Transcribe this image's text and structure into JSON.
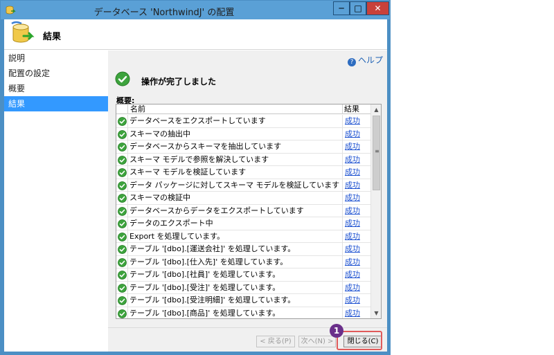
{
  "window": {
    "title": "データベース 'NorthwindJ' の配置",
    "min_glyph": "─",
    "max_glyph": "□",
    "close_glyph": "✕"
  },
  "header": {
    "title": "結果"
  },
  "sidebar": {
    "items": [
      {
        "label": "説明",
        "active": false
      },
      {
        "label": "配置の設定",
        "active": false
      },
      {
        "label": "概要",
        "active": false
      },
      {
        "label": "結果",
        "active": true
      }
    ]
  },
  "content": {
    "help_label": "ヘルプ",
    "status_text": "操作が完了しました",
    "summary_label": "概要:",
    "columns": {
      "name": "名前",
      "result": "結果"
    },
    "rows": [
      {
        "name": "データベースをエクスポートしています",
        "result": "成功"
      },
      {
        "name": "スキーマの抽出中",
        "result": "成功"
      },
      {
        "name": "データベースからスキーマを抽出しています",
        "result": "成功"
      },
      {
        "name": "スキーマ モデルで参照を解決しています",
        "result": "成功"
      },
      {
        "name": "スキーマ モデルを検証しています",
        "result": "成功"
      },
      {
        "name": "データ パッケージに対してスキーマ モデルを検証しています",
        "result": "成功"
      },
      {
        "name": "スキーマの検証中",
        "result": "成功"
      },
      {
        "name": "データベースからデータをエクスポートしています",
        "result": "成功"
      },
      {
        "name": "データのエクスポート中",
        "result": "成功"
      },
      {
        "name": "Export を処理しています。",
        "result": "成功"
      },
      {
        "name": "テーブル '[dbo].[運送会社]' を処理しています。",
        "result": "成功"
      },
      {
        "name": "テーブル '[dbo].[仕入先]' を処理しています。",
        "result": "成功"
      },
      {
        "name": "テーブル '[dbo].[社員]' を処理しています。",
        "result": "成功"
      },
      {
        "name": "テーブル '[dbo].[受注]' を処理しています。",
        "result": "成功"
      },
      {
        "name": "テーブル '[dbo].[受注明細]' を処理しています。",
        "result": "成功"
      },
      {
        "name": "テーブル '[dbo].[商品]' を処理しています。",
        "result": "成功"
      }
    ]
  },
  "footer": {
    "back_label": "< 戻る(P)",
    "next_label": "次へ(N) >",
    "close_label": "閉じる(C)"
  },
  "callout": {
    "number": "1"
  },
  "colors": {
    "titlebar": "#5aa0d6",
    "selection": "#3399ff",
    "success_icon": "#3da33d",
    "link": "#1a4fd0",
    "callout": "#6a2f8a",
    "highlight": "#e05a5a"
  }
}
